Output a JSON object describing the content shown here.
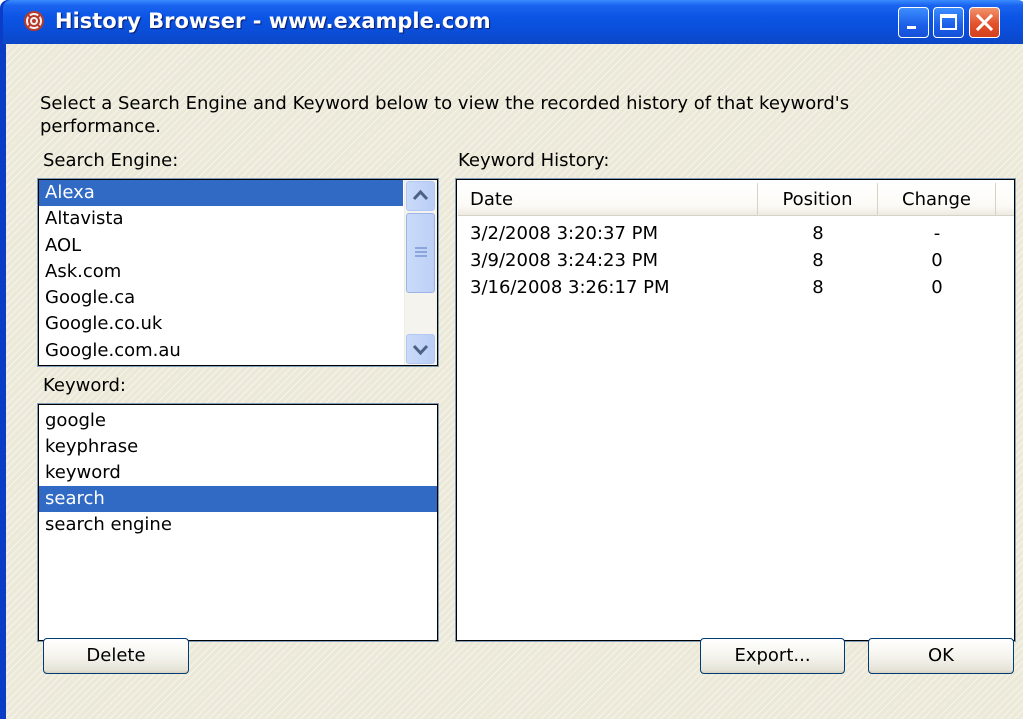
{
  "window": {
    "title": "History Browser - www.example.com"
  },
  "intro": "Select a Search Engine and Keyword below to view the recorded history of that keyword's performance.",
  "search_engine": {
    "label": "Search Engine:",
    "items": [
      "Alexa",
      "Altavista",
      "AOL",
      "Ask.com",
      "Google.ca",
      "Google.co.uk",
      "Google.com.au"
    ],
    "selected": "Alexa"
  },
  "keyword": {
    "label": "Keyword:",
    "items": [
      "google",
      "keyphrase",
      "keyword",
      "search",
      "search engine"
    ],
    "selected": "search"
  },
  "history": {
    "label": "Keyword History:",
    "columns": [
      "Date",
      "Position",
      "Change"
    ],
    "rows": [
      {
        "date": "3/2/2008 3:20:37 PM",
        "position": "8",
        "change": "-"
      },
      {
        "date": "3/9/2008 3:24:23 PM",
        "position": "8",
        "change": "0"
      },
      {
        "date": "3/16/2008 3:26:17 PM",
        "position": "8",
        "change": "0"
      }
    ]
  },
  "buttons": {
    "delete": "Delete",
    "export": "Export...",
    "ok": "OK"
  },
  "colors": {
    "titlebar": "#0a4ed9",
    "selection": "#316ac5",
    "close": "#e2522c",
    "dialog_bg": "#ece9d8"
  },
  "icons": [
    "app-icon",
    "minimize-icon",
    "maximize-icon",
    "close-icon",
    "scroll-up-icon",
    "scroll-down-icon"
  ]
}
